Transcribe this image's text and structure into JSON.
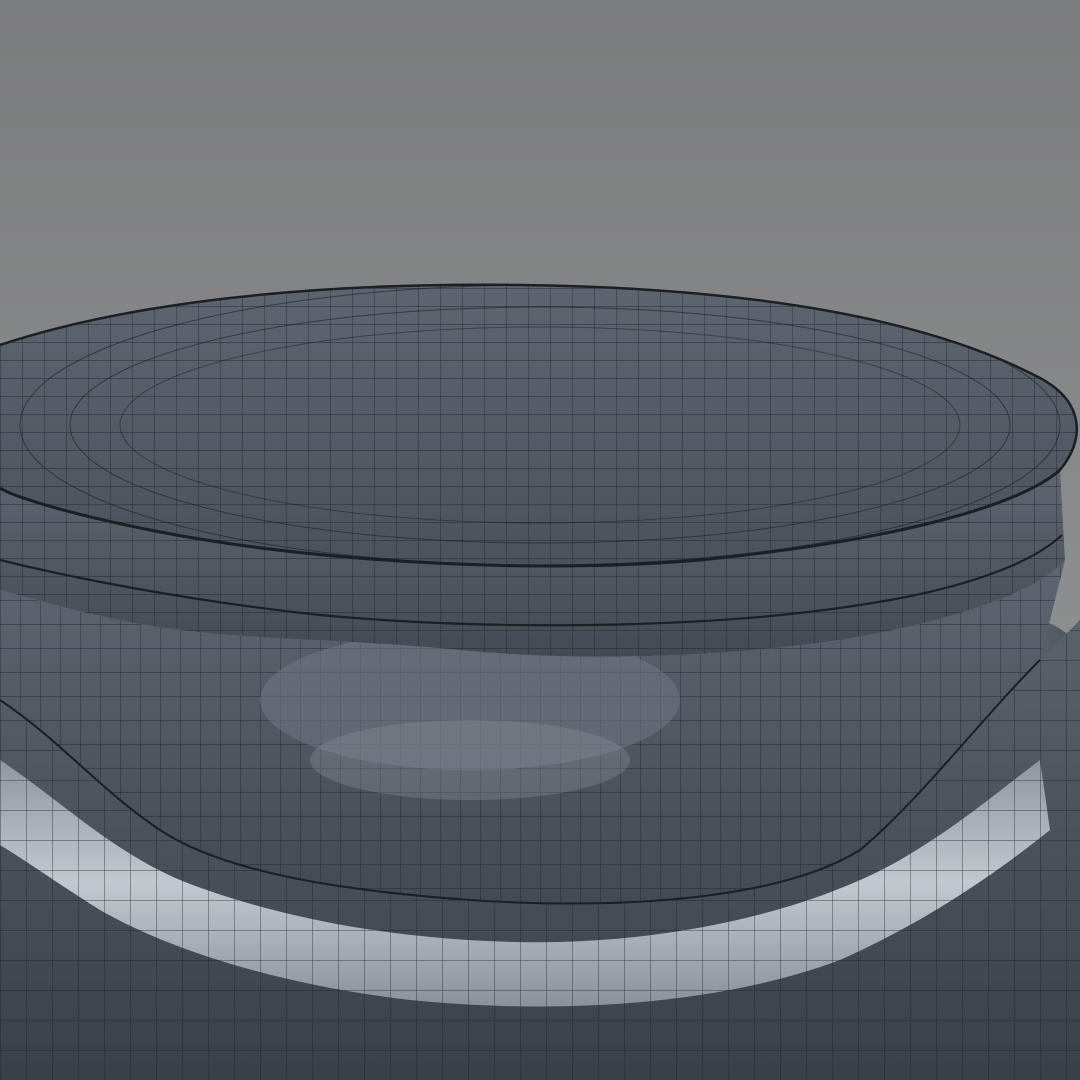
{
  "scene": {
    "subject": "wireframe-mesh-render",
    "colors": {
      "background_top": "#7b7c7d",
      "background_bottom": "#9a9b9c",
      "shell": "#5a626d",
      "shell_dark": "#3c4249",
      "shell_light": "#7a838e",
      "highlight": "#b7bcc2",
      "wire": "#1c1f23"
    }
  }
}
